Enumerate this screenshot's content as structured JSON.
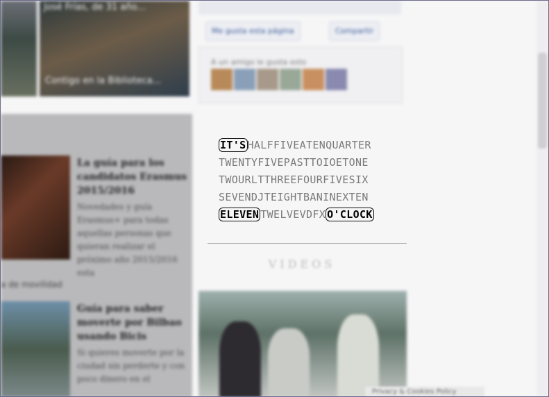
{
  "left": {
    "top_caption": "José Frías, de 31 año...",
    "library_caption": "Contigo en la Biblioteca...",
    "section_label": "a de movilidad",
    "articles": [
      {
        "title": "La guía para los candidatos Erasmus 2015/2016",
        "excerpt": "Novedades y guía Erasmus+ para todas aquellas personas que quieran realizar el próximo año 2015/2016 esta"
      },
      {
        "title": "Guía para saber moverte por Bilbao usando Bicis",
        "excerpt": "Si quieres moverte por la ciudad sin perderte y con poco dinero en el"
      }
    ]
  },
  "social": {
    "like_button": "Me gusta esta página",
    "share_button": "Compartir",
    "friends_text": "A un amigo le gusta esto"
  },
  "clock": {
    "rows": [
      [
        {
          "t": "IT'S",
          "on": true
        },
        {
          "t": "HALFFIVEATENQUARTER",
          "on": false
        }
      ],
      [
        {
          "t": "TWENTYFIVEPASTTOIOETONE",
          "on": false
        }
      ],
      [
        {
          "t": "TWOURLTTHREEFOURFIVESIX",
          "on": false
        }
      ],
      [
        {
          "t": "SEVENDJTEIGHTBANINEXTEN",
          "on": false
        }
      ],
      [
        {
          "t": "ELEVEN",
          "on": true
        },
        {
          "t": "TWELVEVDFX",
          "on": false
        },
        {
          "t": "O'CLOCK",
          "on": true
        }
      ]
    ]
  },
  "videos": {
    "heading": "VIDEOS"
  },
  "cookie_bar": {
    "text": "Privacy & Cookies Policy"
  }
}
